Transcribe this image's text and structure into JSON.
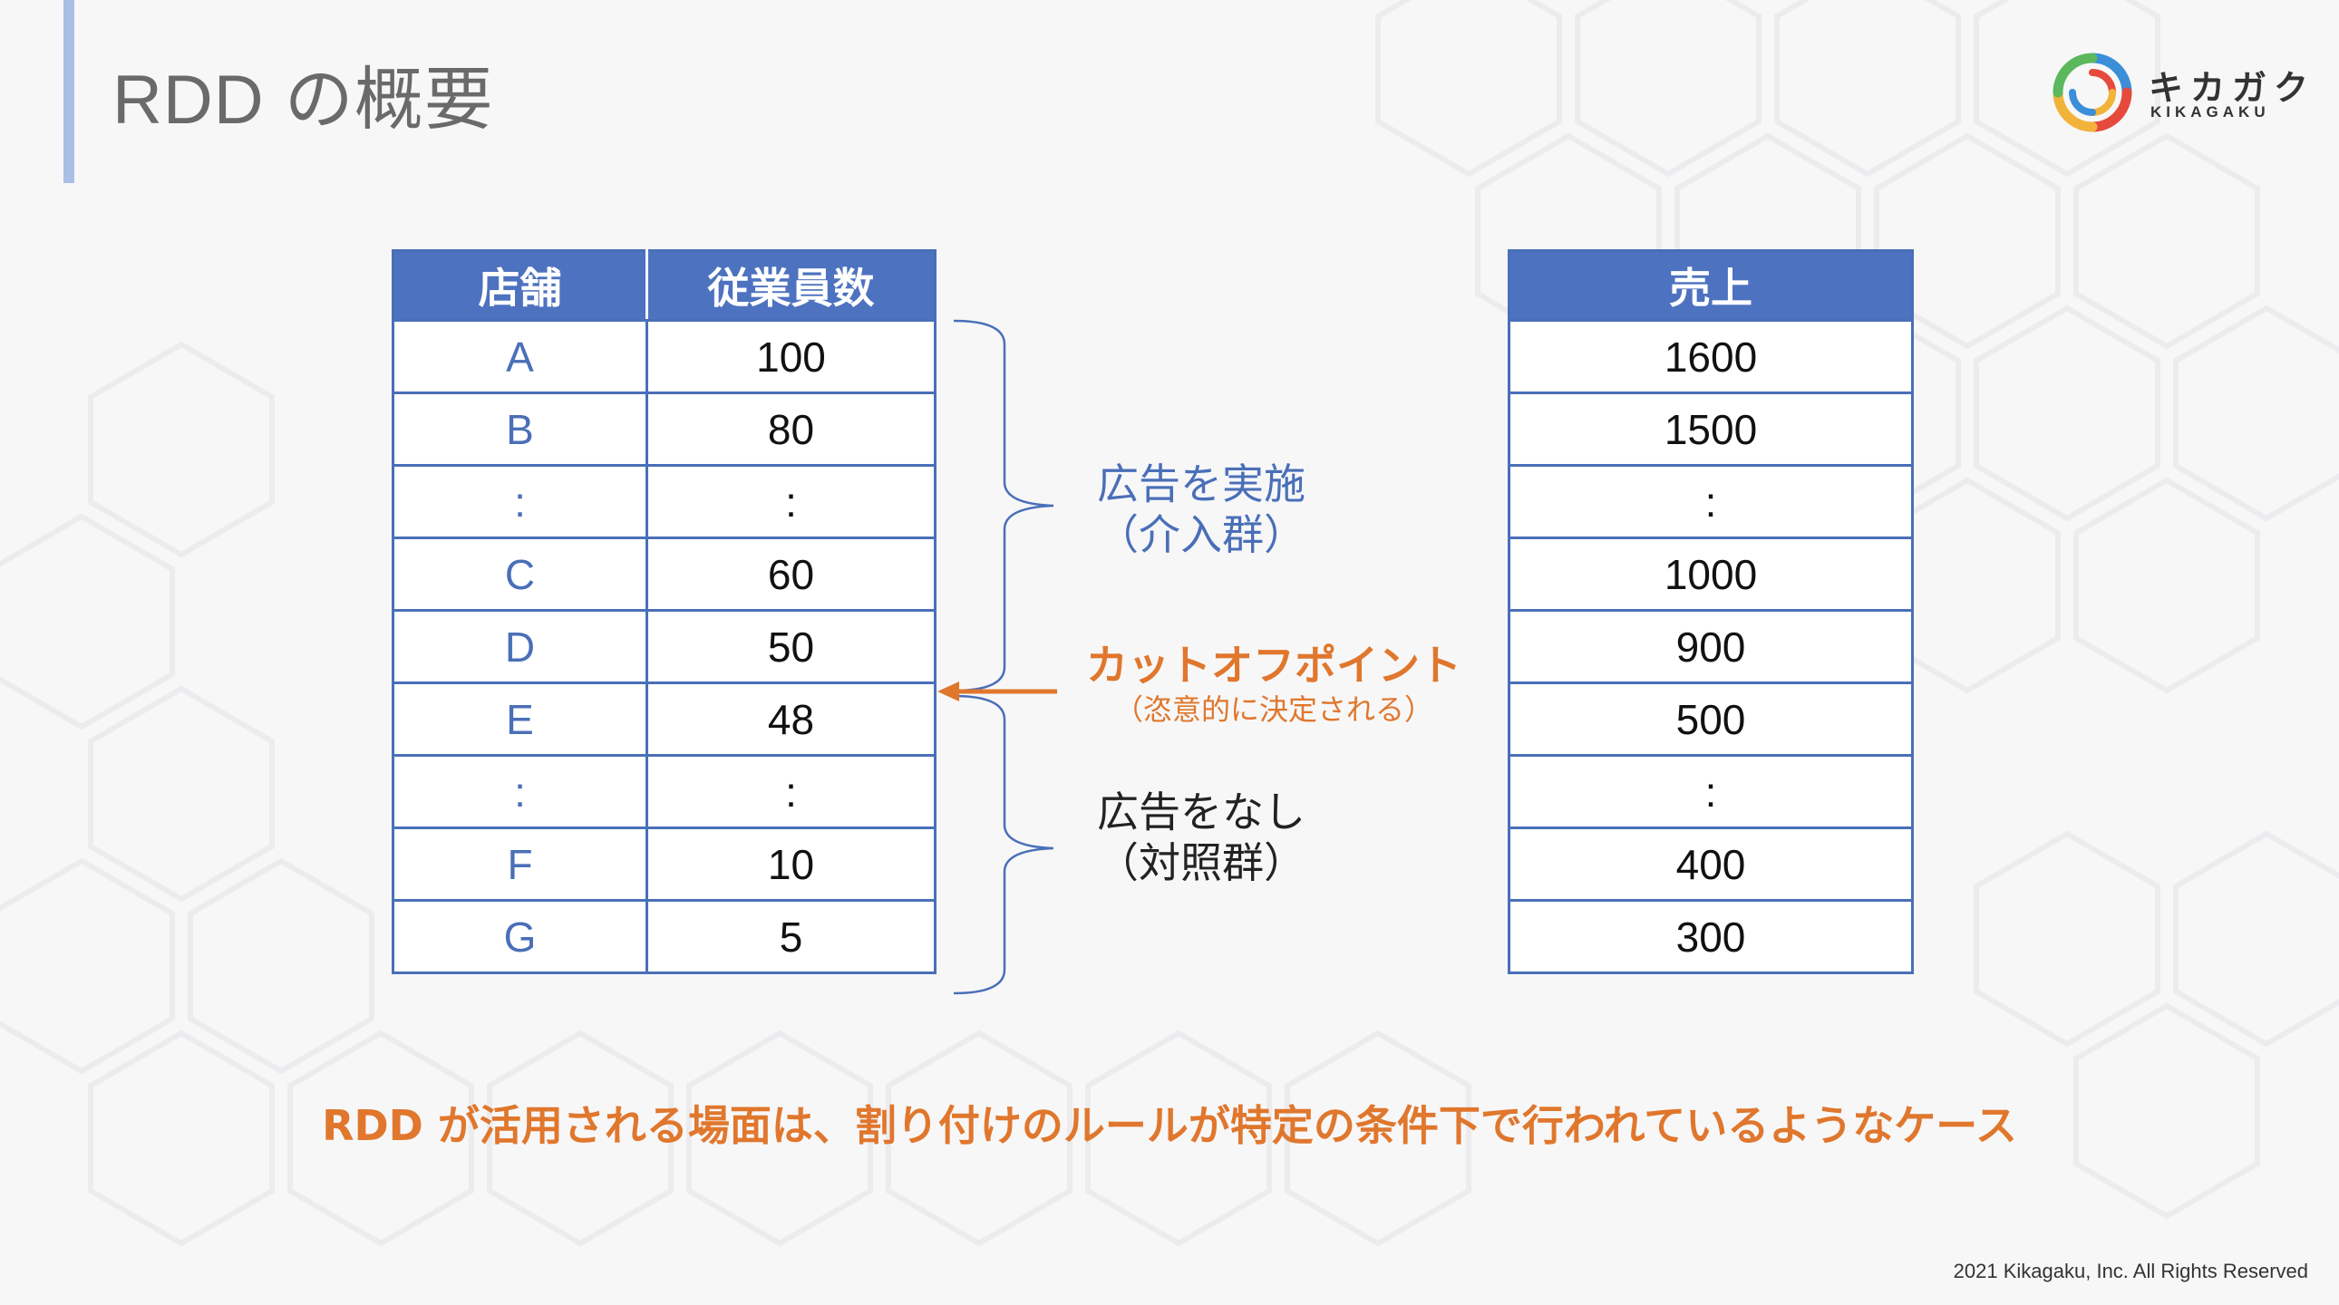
{
  "slide": {
    "title": "RDD の概要",
    "footer": "2021 Kikagaku, Inc. All Rights Reserved"
  },
  "logo": {
    "kana": "キカガク",
    "latin": "KIKAGAKU"
  },
  "store_table": {
    "headers": [
      "店舗",
      "従業員数"
    ],
    "rows": [
      [
        "A",
        "100"
      ],
      [
        "B",
        "80"
      ],
      [
        ":",
        ":"
      ],
      [
        "C",
        "60"
      ],
      [
        "D",
        "50"
      ],
      [
        "E",
        "48"
      ],
      [
        ":",
        ":"
      ],
      [
        "F",
        "10"
      ],
      [
        "G",
        "5"
      ]
    ]
  },
  "sales_table": {
    "header": "売上",
    "rows": [
      "1600",
      "1500",
      ":",
      "1000",
      "900",
      "500",
      ":",
      "400",
      "300"
    ]
  },
  "annotations": {
    "treatment_line1": "広告を実施",
    "treatment_line2": "（介入群）",
    "cutoff_title": "カットオフポイント",
    "cutoff_sub": "（恣意的に決定される）",
    "control_line1": "広告をなし",
    "control_line2": "（対照群）"
  },
  "conclusion": "RDD が活用される場面は、割り付けのルールが特定の条件下で行われているようなケース",
  "colors": {
    "accent_blue": "#4d72bf",
    "accent_orange": "#e0772d",
    "title_bar": "#a9c0e4"
  }
}
